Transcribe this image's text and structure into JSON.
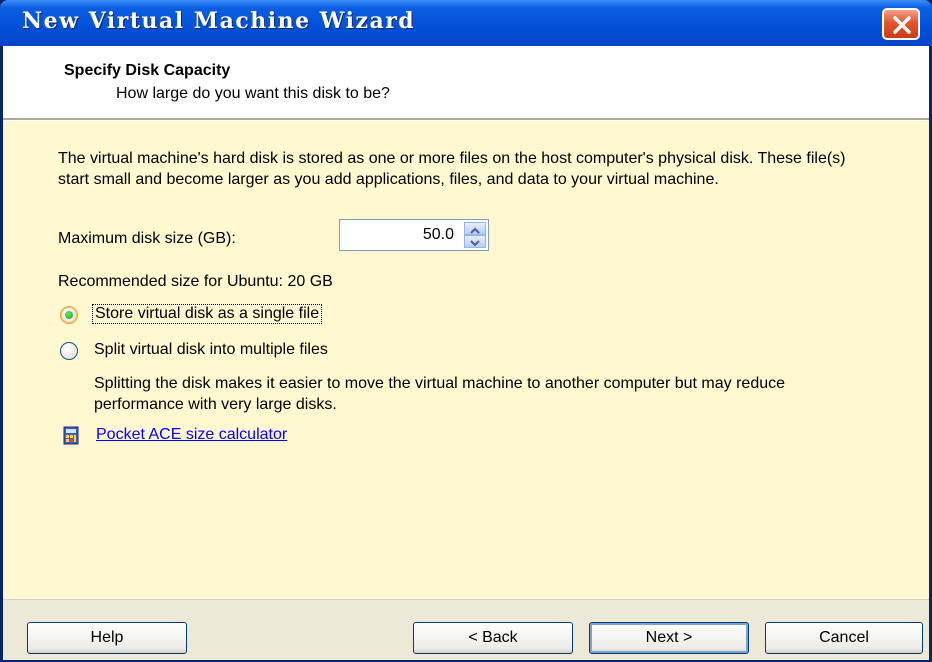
{
  "window": {
    "title": "New Virtual Machine Wizard"
  },
  "header": {
    "title": "Specify Disk Capacity",
    "subtitle": "How large do you want this disk to be?"
  },
  "content": {
    "description": "The virtual machine's hard disk is stored as one or more files on the host computer's physical disk. These file(s) start small and become larger as you add applications, files, and data to your virtual machine.",
    "max_disk_label": "Maximum disk size (GB):",
    "max_disk_value": "50.0",
    "recommended": "Recommended size for Ubuntu: 20 GB",
    "options": {
      "single_file": "Store virtual disk as a single file",
      "multiple_files": "Split virtual disk into multiple files",
      "selected": "single_file"
    },
    "split_description": "Splitting the disk makes it easier to move the virtual machine to another computer but may reduce performance with very large disks.",
    "calculator_link": "Pocket ACE size calculator"
  },
  "buttons": {
    "help": "Help",
    "back": "< Back",
    "next": "Next >",
    "cancel": "Cancel"
  },
  "colors": {
    "titlebar": "#0350d8",
    "content_bg": "#fff8d0",
    "link": "#0000ff"
  }
}
